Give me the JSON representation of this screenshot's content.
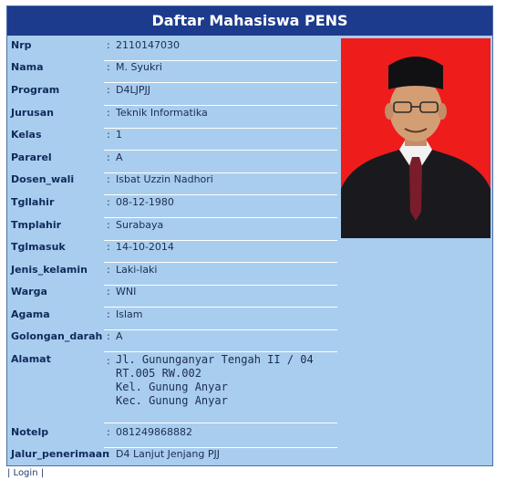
{
  "header": {
    "title": "Daftar Mahasiswa PENS"
  },
  "separator": ":",
  "fields": {
    "nrp": {
      "label": "Nrp",
      "value": "2110147030"
    },
    "nama": {
      "label": "Nama",
      "value": "M. Syukri"
    },
    "program": {
      "label": "Program",
      "value": "D4LJPJJ"
    },
    "jurusan": {
      "label": "Jurusan",
      "value": "Teknik Informatika"
    },
    "kelas": {
      "label": "Kelas",
      "value": "1"
    },
    "pararel": {
      "label": "Pararel",
      "value": "A"
    },
    "dosen_wali": {
      "label": "Dosen_wali",
      "value": "Isbat Uzzin Nadhori"
    },
    "tgllahir": {
      "label": "Tgllahir",
      "value": "08-12-1980"
    },
    "tmplahir": {
      "label": "Tmplahir",
      "value": "Surabaya"
    },
    "tglmasuk": {
      "label": "Tglmasuk",
      "value": "14-10-2014"
    },
    "jenis_kelamin": {
      "label": "Jenis_kelamin",
      "value": "Laki-laki"
    },
    "warga": {
      "label": "Warga",
      "value": "WNI"
    },
    "agama": {
      "label": "Agama",
      "value": "Islam"
    },
    "golongan_darah": {
      "label": "Golongan_darah",
      "value": "A"
    },
    "alamat": {
      "label": "Alamat",
      "value": "Jl. Gununganyar Tengah II / 04\nRT.005 RW.002\nKel. Gunung Anyar\nKec. Gunung Anyar"
    },
    "notelp": {
      "label": "Notelp",
      "value": "081249868882"
    },
    "jalur_penerimaan": {
      "label": "Jalur_penerimaan",
      "value": "D4 Lanjut Jenjang PJJ"
    }
  },
  "photo": {
    "background": "#ef1c1c"
  },
  "footer": {
    "login_link": "| Login |"
  }
}
